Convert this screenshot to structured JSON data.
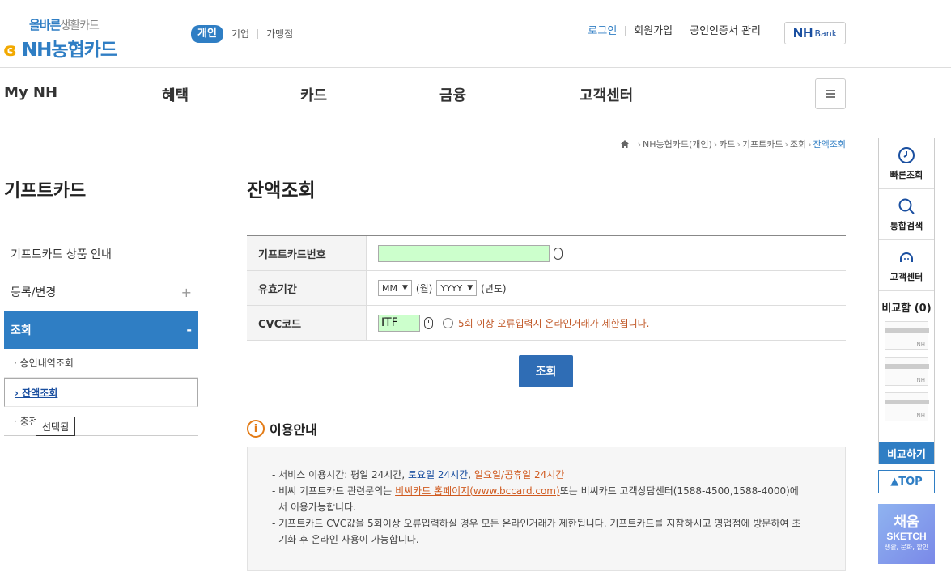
{
  "header": {
    "slogan_main": "올바른",
    "slogan_sub": "생활카드",
    "brand_nh": "NH",
    "brand_kr": "농협카드",
    "segments": [
      "개인",
      "기업",
      "가맹점"
    ],
    "util_links": [
      "로그인",
      "회원가입",
      "공인인증서 관리"
    ],
    "nhbank_1": "NH",
    "nhbank_2": "Bank"
  },
  "gnb": [
    "My NH",
    "혜택",
    "카드",
    "금융",
    "고객센터"
  ],
  "breadcrumb": [
    "NH농협카드(개인)",
    "카드",
    "기프트카드",
    "조회",
    "잔액조회"
  ],
  "lnb": {
    "title": "기프트카드",
    "items": [
      {
        "label": "기프트카드 상품 안내",
        "sign": ""
      },
      {
        "label": "등록/변경",
        "sign": "+"
      },
      {
        "label": "조회",
        "sign": "-"
      }
    ],
    "sub": [
      "· 승인내역조회",
      "› 잔액조회",
      "· 충전"
    ],
    "tooltip": "선택됨"
  },
  "main": {
    "title": "잔액조회",
    "rows": {
      "card_label": "기프트카드번호",
      "period_label": "유효기간",
      "month": "MM",
      "month_suffix": "(월)",
      "year": "YYYY",
      "year_suffix": "(년도)",
      "cvc_label": "CVC코드",
      "cvc_value": "ITF",
      "cvc_warn": "5회 이상 오류입력시 온라인거래가 제한됩니다."
    },
    "search_button": "조회",
    "guide_title": "이용안내",
    "guide": {
      "l1_a": "- 서비스 이용시간: 평일 24시간, ",
      "l1_b": "토요일 24시간",
      "l1_c": ", ",
      "l1_d": "일요일/공휴일 24시간",
      "l2_a": "- 비씨 기프트카드 관련문의는 ",
      "l2_b": "비씨카드 홈페이지(www.bccard.com)",
      "l2_c": "또는 비씨카드 고객상담센터(1588-4500,1588-4000)에",
      "l2_d": "서 이용가능합니다.",
      "l3_a": "- 기프트카드 CVC값을 5회이상 오류입력하실 경우 모든 온라인거래가 제한됩니다. 기프트카드를 지참하시고 영업점에 방문하여 초",
      "l3_b": "기화 후 온라인 사용이 가능합니다."
    }
  },
  "quick": {
    "items": [
      "빠른조회",
      "통합검색",
      "고객센터"
    ],
    "compare": "비교함 (0)",
    "slot_tag": "NH",
    "compare_btn": "비교하기",
    "top": "▲TOP",
    "sketch_a": "채움",
    "sketch_b": "SKETCH",
    "sketch_c": "생활, 문화, 할인"
  }
}
